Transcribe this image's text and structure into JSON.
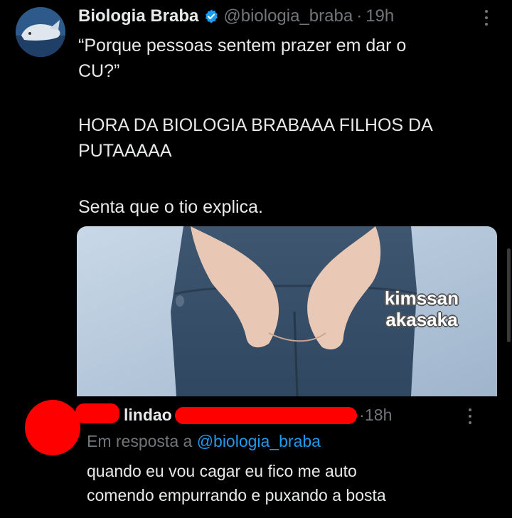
{
  "tweet": {
    "display_name": "Biologia Braba",
    "handle": "@biologia_braba",
    "separator": "·",
    "time": "19h",
    "avatar_icon": "whale-avatar-icon",
    "verified_icon": "verified-badge-icon",
    "more_icon": "more-options-icon",
    "text_lines": [
      "“Porque pessoas sentem prazer em dar o",
      "CU?”",
      "HORA DA BIOLOGIA BRABAAA FILHOS DA",
      "PUTAAAAA",
      "Senta que o tio explica."
    ],
    "media": {
      "watermark_lines": [
        "kimssan",
        "akasaka"
      ]
    }
  },
  "reply": {
    "display_name": "lindao",
    "separator": "·",
    "time": "18h",
    "replying_prefix": "Em resposta a",
    "replying_to": "@biologia_braba",
    "text_lines": [
      "quando eu vou cagar eu fico me auto",
      "comendo empurrando e puxando a bosta"
    ],
    "more_icon": "more-options-icon",
    "redaction_color": "#ff0000"
  },
  "colors": {
    "background": "#000000",
    "text": "#e7e9ea",
    "muted": "#71767b",
    "accent": "#1d9bf0"
  }
}
